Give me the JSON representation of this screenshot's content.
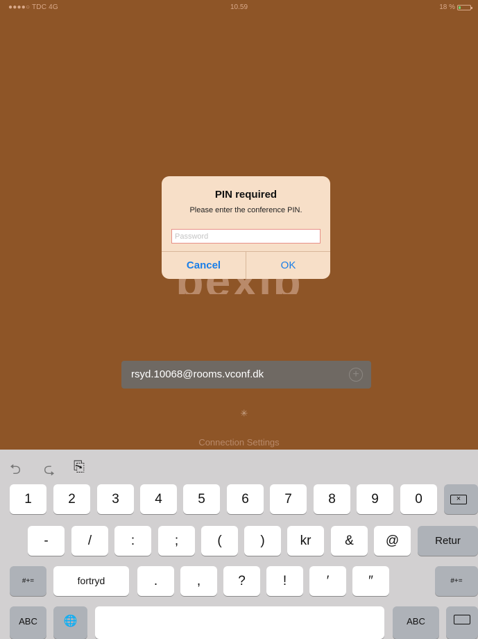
{
  "status": {
    "carrier": "●●●●○ TDC  4G",
    "time": "10.59",
    "battery_text": "18 %",
    "battery_level": 0.18,
    "battery_color": "#6fd46f"
  },
  "background_color": "#8e5527",
  "logo_text": "pexip",
  "address": {
    "value": "rsyd.10068@rooms.vconf.dk",
    "add_icon": "+"
  },
  "spinner": "✳",
  "connection_settings": "Connection Settings",
  "dialog": {
    "title": "PIN required",
    "message": "Please enter the conference PIN.",
    "input_placeholder": "Password",
    "cancel_label": "Cancel",
    "ok_label": "OK"
  },
  "keyboard": {
    "tools": {
      "undo": "⮌",
      "redo": "⮎",
      "paste": "⎘"
    },
    "row1": [
      "1",
      "2",
      "3",
      "4",
      "5",
      "6",
      "7",
      "8",
      "9",
      "0"
    ],
    "row2": [
      "-",
      "/",
      ":",
      ";",
      "(",
      ")",
      "kr",
      "&",
      "@"
    ],
    "return_label": "Retur",
    "shift_label": "#+=",
    "undo_label": "fortryd",
    "row3": [
      ".",
      ",",
      "?",
      "!",
      "′",
      "″"
    ],
    "shift_right_label": "#+=",
    "abc_left": "ABC",
    "globe": "🌐",
    "abc_right": "ABC"
  }
}
